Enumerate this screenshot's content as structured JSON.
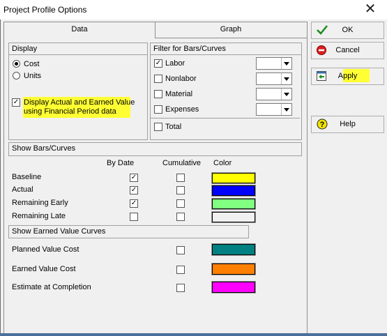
{
  "window": {
    "title": "Project Profile Options",
    "close_glyph": "✕"
  },
  "tabs": {
    "data": "Data",
    "graph": "Graph"
  },
  "display": {
    "header": "Display",
    "cost": "Cost",
    "units": "Units",
    "financial_line1": "Display Actual and Earned Value",
    "financial_line2": "using Financial Period data"
  },
  "filter": {
    "header": "Filter for Bars/Curves",
    "labor": "Labor",
    "nonlabor": "Nonlabor",
    "material": "Material",
    "expenses": "Expenses",
    "total": "Total"
  },
  "bars": {
    "header": "Show Bars/Curves",
    "col_by_date": "By Date",
    "col_cumulative": "Cumulative",
    "col_color": "Color",
    "rows": [
      {
        "label": "Baseline",
        "by_date": true,
        "cumulative": false,
        "color": "#ffff00"
      },
      {
        "label": "Actual",
        "by_date": true,
        "cumulative": false,
        "color": "#0000ff"
      },
      {
        "label": "Remaining Early",
        "by_date": true,
        "cumulative": false,
        "color": "#80ff80"
      },
      {
        "label": "Remaining Late",
        "by_date": false,
        "cumulative": false,
        "color": "#f0f0f0"
      }
    ]
  },
  "earned": {
    "header": "Show Earned Value Curves",
    "rows": [
      {
        "label": "Planned Value Cost",
        "cumulative": false,
        "color": "#008080"
      },
      {
        "label": "Earned Value Cost",
        "cumulative": false,
        "color": "#ff8000"
      },
      {
        "label": "Estimate at Completion",
        "cumulative": false,
        "color": "#ff00ff"
      }
    ]
  },
  "buttons": {
    "ok": "OK",
    "cancel": "Cancel",
    "apply": "Apply",
    "help": "Help"
  },
  "check_glyph": "✓",
  "highlight_color": "#ffff33"
}
